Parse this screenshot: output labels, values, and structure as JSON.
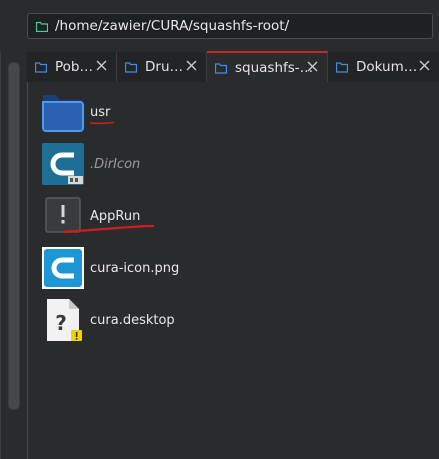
{
  "path_bar": {
    "path": "/home/zawier/CURA/squashfs-root/"
  },
  "tabs": [
    {
      "label": "Pob…",
      "active": false
    },
    {
      "label": "Dru…",
      "active": false
    },
    {
      "label": "squashfs-…",
      "active": true
    },
    {
      "label": "Dokum…",
      "active": false
    }
  ],
  "files": [
    {
      "name": "usr",
      "icon": "folder-icon"
    },
    {
      "name": ".DirIcon",
      "icon": "cura-image-icon",
      "hidden": true
    },
    {
      "name": "AppRun",
      "icon": "executable-icon"
    },
    {
      "name": "cura-icon.png",
      "icon": "cura-image-icon"
    },
    {
      "name": "cura.desktop",
      "icon": "unknown-file-icon"
    }
  ],
  "colors": {
    "accent_red": "#c1272d",
    "folder_blue": "#3d8ee8",
    "cura_blue": "#1e96d3"
  }
}
